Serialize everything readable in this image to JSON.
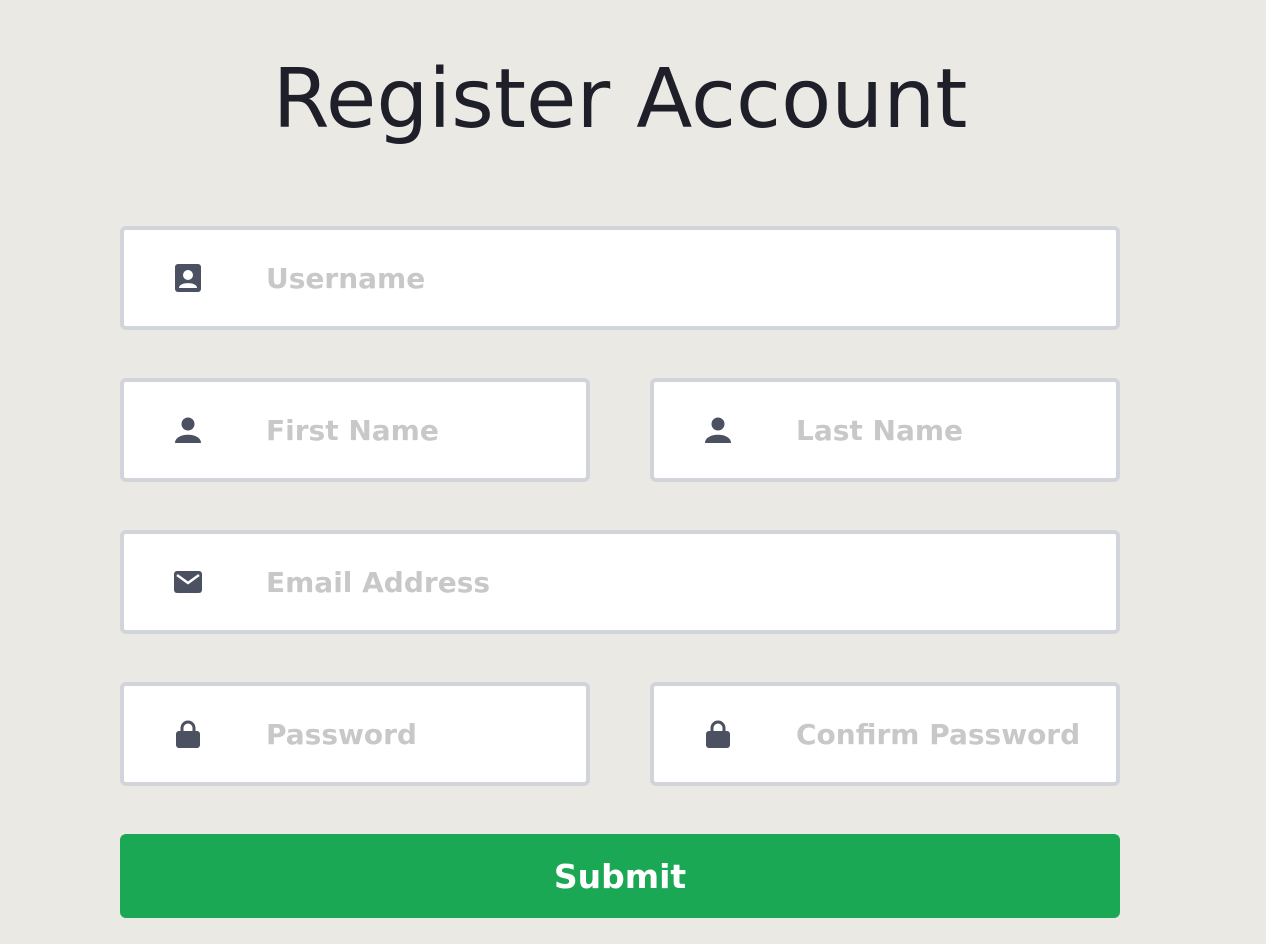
{
  "page": {
    "title": "Register Account"
  },
  "form": {
    "username": {
      "placeholder": "Username",
      "value": "",
      "icon": "contact-card-icon"
    },
    "first_name": {
      "placeholder": "First Name",
      "value": "",
      "icon": "person-icon"
    },
    "last_name": {
      "placeholder": "Last Name",
      "value": "",
      "icon": "person-icon"
    },
    "email": {
      "placeholder": "Email Address",
      "value": "",
      "icon": "envelope-icon"
    },
    "password": {
      "placeholder": "Password",
      "value": "",
      "icon": "lock-icon"
    },
    "confirm_password": {
      "placeholder": "Confirm Password",
      "value": "",
      "icon": "lock-icon"
    },
    "submit_label": "Submit"
  },
  "colors": {
    "background": "#ebe9e4",
    "field_border": "#d1d5db",
    "placeholder": "#c8c8c8",
    "icon": "#4b5160",
    "title": "#1f1f2a",
    "submit": "#1aa855"
  }
}
